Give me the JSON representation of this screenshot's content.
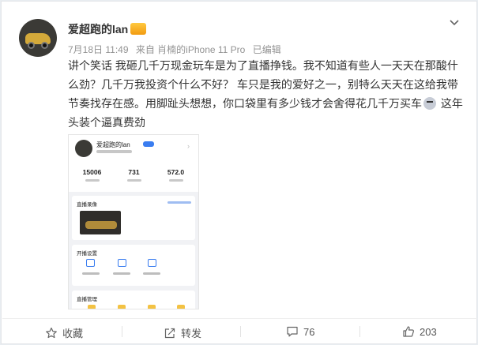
{
  "post": {
    "author": "爱超跑的lan",
    "vip_badge": "会员",
    "meta": {
      "date": "7月18日 11:49",
      "source": "来自 肖楠的iPhone 11 Pro",
      "edited": "已编辑"
    },
    "text_line1": "讲个笑话 我砸几千万现金玩车是为了直播挣钱。我不知道有些人一天天在那酸什",
    "text_line2": "么劲？几千万我投资个什么不好？ 车只是我的爱好之一，别特么天天在这给我带",
    "text_line3": "节奏找存在感。用脚趾头想想，你口袋里有多少钱才会舍得花几千万买车",
    "text_line3_tail": " 这年",
    "text_line4": "头装个逼真费劲",
    "emoji_icon": "face-emoji-icon"
  },
  "screenshot": {
    "name": "爱超跑的lan",
    "stats": [
      "15006",
      "731",
      "572.0"
    ],
    "section_live": "直播录像",
    "section_settings": "开播设置",
    "section_manage": "直播管理"
  },
  "actions": {
    "favorite": "收藏",
    "repost": "转发",
    "comments": "76",
    "likes": "203"
  },
  "colors": {
    "accent": "#3a7df0",
    "meta_gray": "#939393",
    "vip": "#f29b11"
  }
}
